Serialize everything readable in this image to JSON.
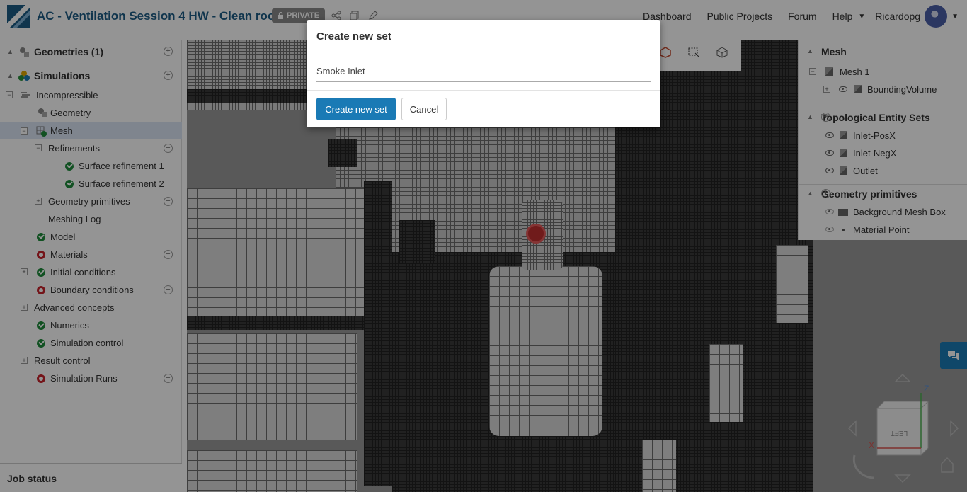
{
  "header": {
    "project_title": "AC - Ventilation Session 4 HW - Clean room",
    "private_badge": "PRIVATE",
    "nav": [
      "Dashboard",
      "Public Projects",
      "Forum",
      "Help"
    ],
    "username": "Ricardopg"
  },
  "sidebar": {
    "geometries": "Geometries (1)",
    "simulations": "Simulations",
    "items": [
      {
        "label": "Incompressible"
      },
      {
        "label": "Geometry"
      },
      {
        "label": "Mesh"
      },
      {
        "label": "Refinements"
      },
      {
        "label": "Surface refinement 1"
      },
      {
        "label": "Surface refinement 2"
      },
      {
        "label": "Geometry primitives"
      },
      {
        "label": "Meshing Log"
      },
      {
        "label": "Model"
      },
      {
        "label": "Materials"
      },
      {
        "label": "Initial conditions"
      },
      {
        "label": "Boundary conditions"
      },
      {
        "label": "Advanced concepts"
      },
      {
        "label": "Numerics"
      },
      {
        "label": "Simulation control"
      },
      {
        "label": "Result control"
      },
      {
        "label": "Simulation Runs"
      }
    ],
    "job_status": "Job status"
  },
  "right_panel": {
    "mesh_header": "Mesh",
    "mesh_item": "Mesh 1",
    "mesh_child": "BoundingVolume",
    "sets_header": "Topological Entity Sets",
    "sets": [
      "Inlet-PosX",
      "Inlet-NegX",
      "Outlet"
    ],
    "primitives_header": "Geometry primitives",
    "primitives": [
      "Background Mesh Box",
      "Material Point"
    ]
  },
  "axes": {
    "z": "Z",
    "x": "X",
    "cube_face": "LEFT"
  },
  "modal": {
    "title": "Create new set",
    "input_value": "Smoke Inlet",
    "create_label": "Create new set",
    "cancel_label": "Cancel"
  },
  "colors": {
    "brand": "#1d5c85",
    "primary": "#1a7ab5",
    "ok": "#1e8c3c",
    "error": "#c8232c"
  }
}
